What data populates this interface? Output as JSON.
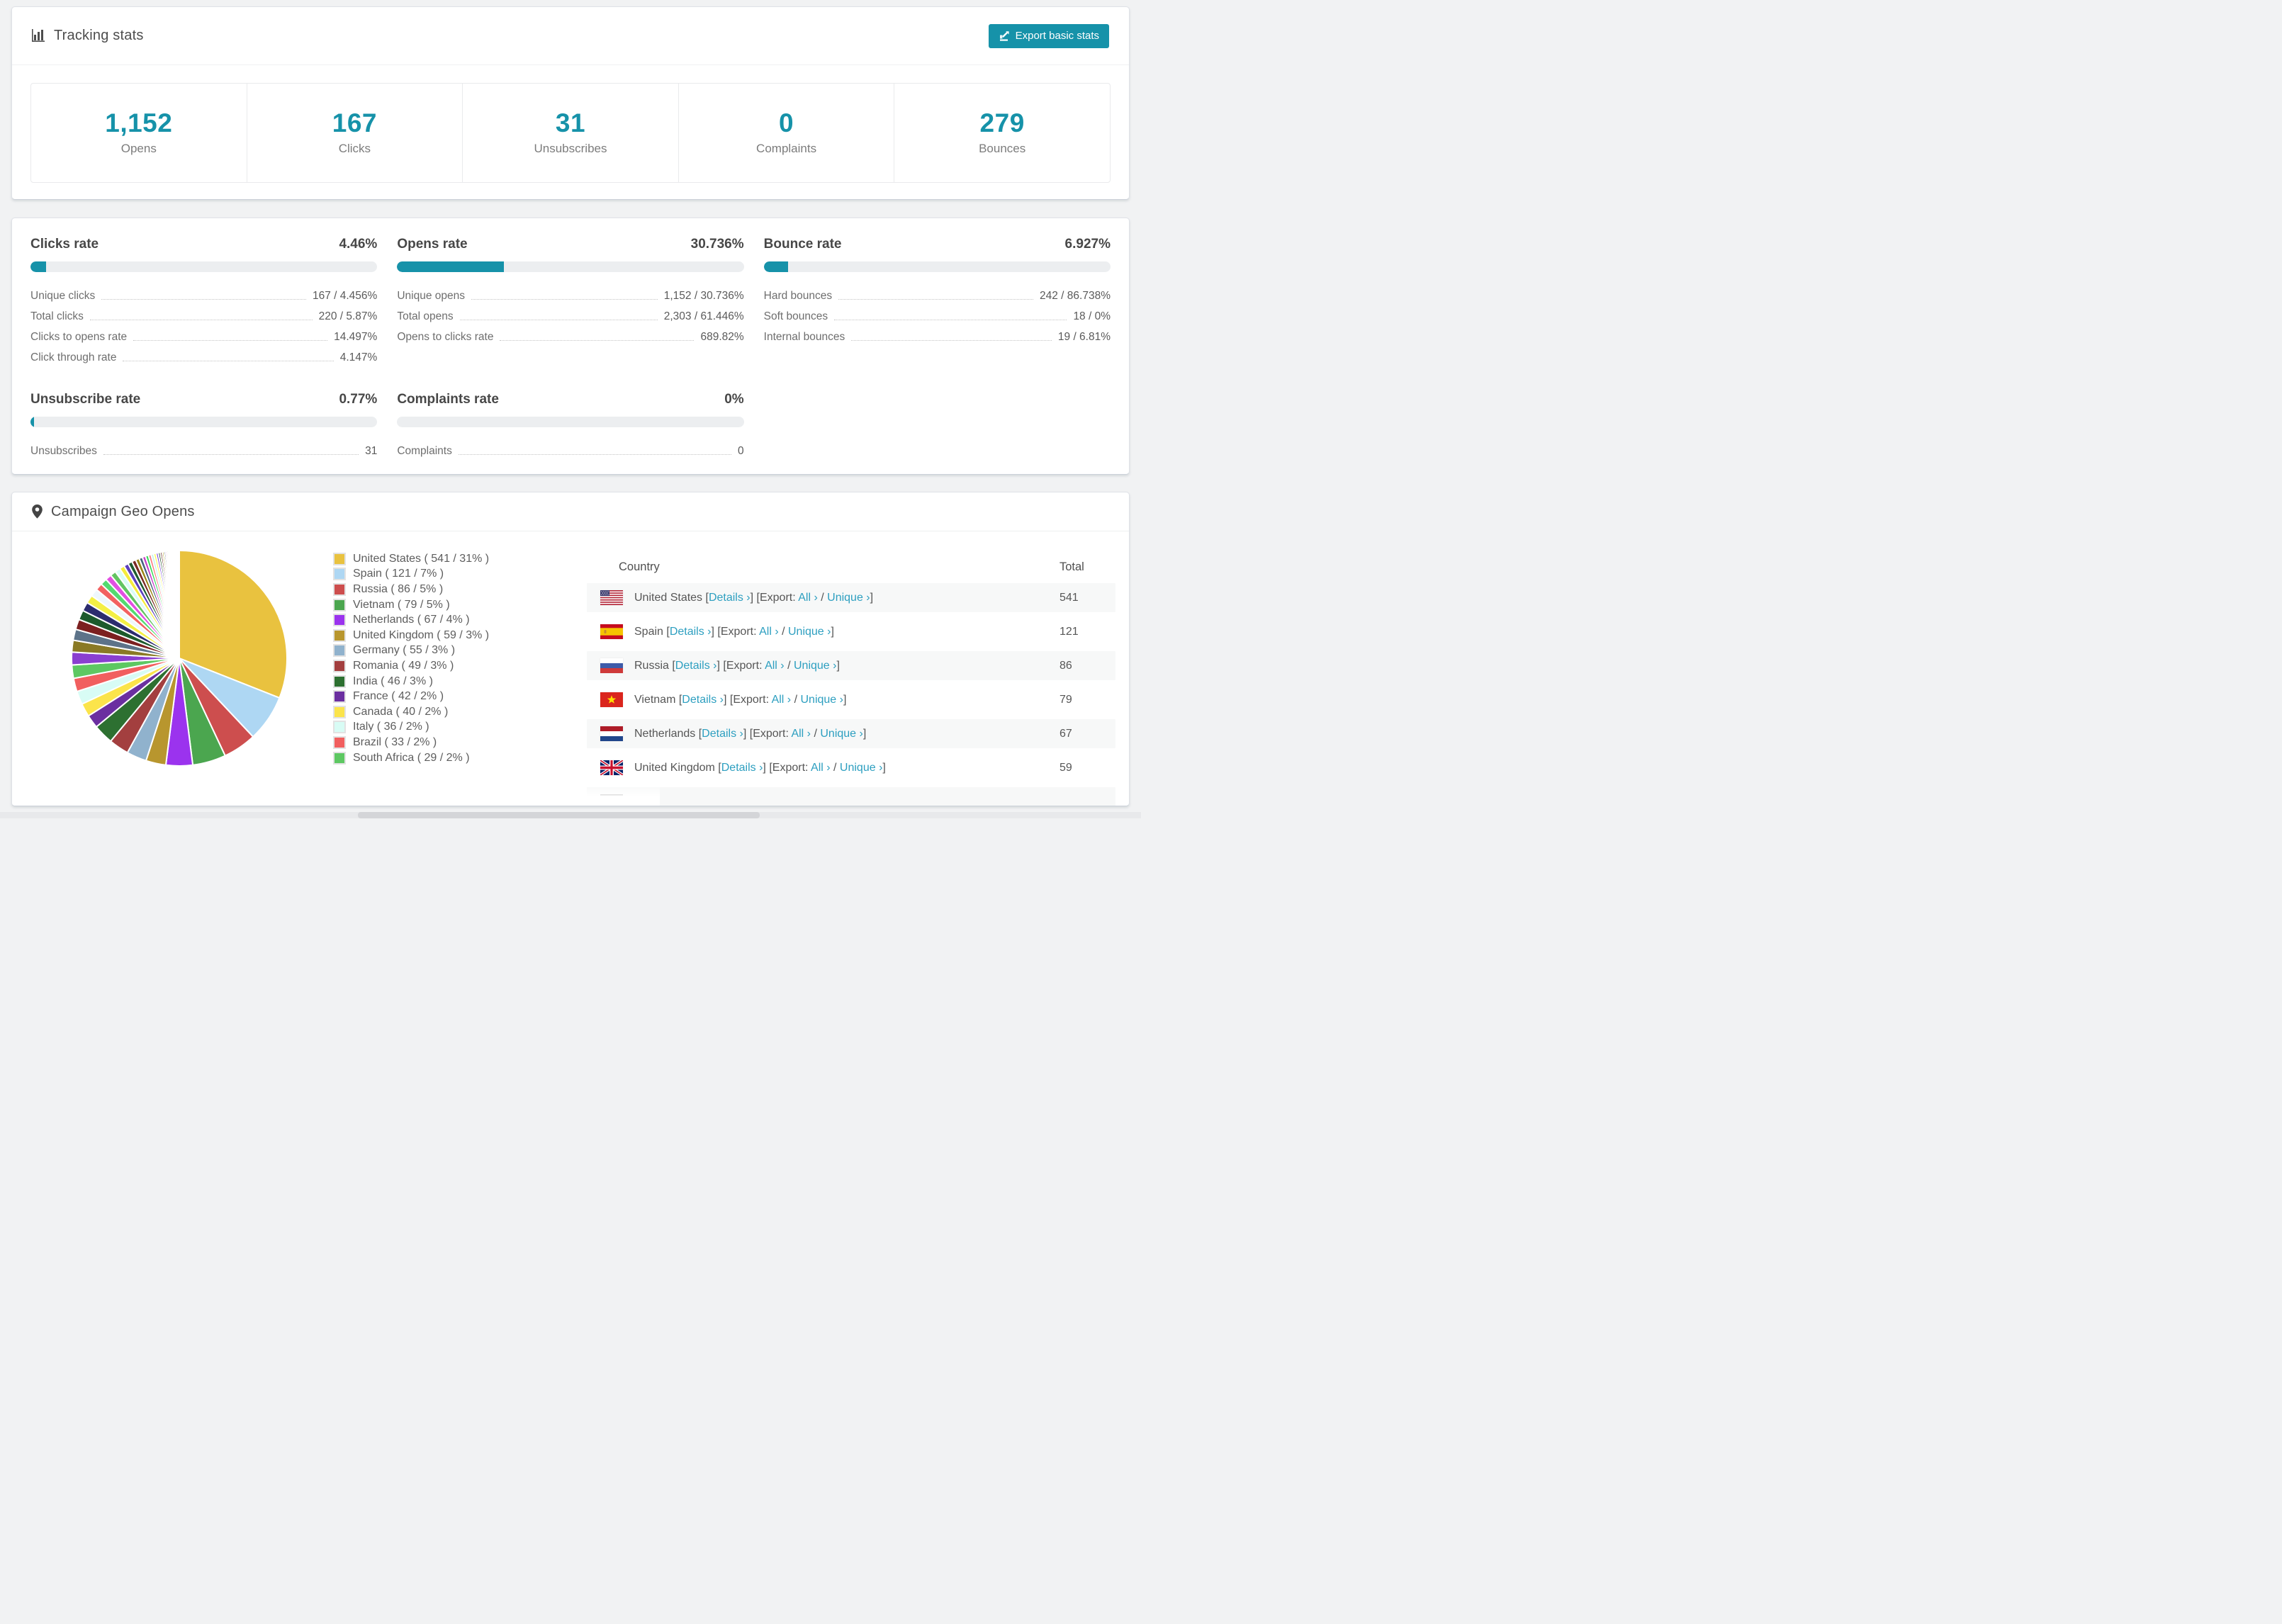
{
  "accent_color": "#1692a9",
  "link_color": "#2d9fc0",
  "header": {
    "title": "Tracking stats",
    "export_button": "Export basic stats",
    "icons": {
      "title": "bar-chart-icon",
      "export": "export-icon"
    }
  },
  "summary": [
    {
      "value": "1,152",
      "label": "Opens"
    },
    {
      "value": "167",
      "label": "Clicks"
    },
    {
      "value": "31",
      "label": "Unsubscribes"
    },
    {
      "value": "0",
      "label": "Complaints"
    },
    {
      "value": "279",
      "label": "Bounces"
    }
  ],
  "rates_order": [
    "clicks",
    "opens",
    "bounce",
    "unsubscribe",
    "complaints"
  ],
  "rates": {
    "clicks": {
      "title": "Clicks rate",
      "percent_label": "4.46%",
      "bar_percent": 4.46,
      "rows": [
        {
          "label": "Unique clicks",
          "value": "167 / 4.456%"
        },
        {
          "label": "Total clicks",
          "value": "220 / 5.87%"
        },
        {
          "label": "Clicks to opens rate",
          "value": "14.497%"
        },
        {
          "label": "Click through rate",
          "value": "4.147%"
        }
      ]
    },
    "opens": {
      "title": "Opens rate",
      "percent_label": "30.736%",
      "bar_percent": 30.736,
      "rows": [
        {
          "label": "Unique opens",
          "value": "1,152 / 30.736%"
        },
        {
          "label": "Total opens",
          "value": "2,303 / 61.446%"
        },
        {
          "label": "Opens to clicks rate",
          "value": "689.82%"
        }
      ]
    },
    "bounce": {
      "title": "Bounce rate",
      "percent_label": "6.927%",
      "bar_percent": 6.927,
      "rows": [
        {
          "label": "Hard bounces",
          "value": "242 / 86.738%"
        },
        {
          "label": "Soft bounces",
          "value": "18 / 0%"
        },
        {
          "label": "Internal bounces",
          "value": "19 / 6.81%"
        }
      ]
    },
    "unsubscribe": {
      "title": "Unsubscribe rate",
      "percent_label": "0.77%",
      "bar_percent": 0.77,
      "rows": [
        {
          "label": "Unsubscribes",
          "value": "31"
        }
      ]
    },
    "complaints": {
      "title": "Complaints rate",
      "percent_label": "0%",
      "bar_percent": 0,
      "rows": [
        {
          "label": "Complaints",
          "value": "0"
        }
      ]
    }
  },
  "geo": {
    "title": "Campaign Geo Opens",
    "icon": "map-pin-icon",
    "table": {
      "columns": [
        "Country",
        "Total"
      ],
      "link_labels": {
        "details": "Details",
        "export": "Export:",
        "all": "All",
        "unique": "Unique",
        "chevron": "›"
      },
      "rows": [
        {
          "country": "United States",
          "flag": "us",
          "total": "541"
        },
        {
          "country": "Spain",
          "flag": "es",
          "total": "121"
        },
        {
          "country": "Russia",
          "flag": "ru",
          "total": "86"
        },
        {
          "country": "Vietnam",
          "flag": "vn",
          "total": "79"
        },
        {
          "country": "Netherlands",
          "flag": "nl",
          "total": "67"
        },
        {
          "country": "United Kingdom",
          "flag": "gb",
          "total": "59"
        }
      ],
      "partial_row_flag": "de"
    },
    "chart_data": {
      "type": "pie",
      "title": "Campaign Geo Opens",
      "legend_position": "right-of-pie",
      "start_angle_deg": 0,
      "direction": "clockwise",
      "labels": [
        "United States",
        "Spain",
        "Russia",
        "Vietnam",
        "Netherlands",
        "United Kingdom",
        "Germany",
        "Romania",
        "India",
        "France",
        "Canada",
        "Italy",
        "Brazil",
        "South Africa"
      ],
      "counts": [
        541,
        121,
        86,
        79,
        67,
        59,
        55,
        49,
        46,
        42,
        40,
        36,
        33,
        29
      ],
      "percents": [
        31,
        7,
        5,
        5,
        4,
        3,
        3,
        3,
        3,
        2,
        2,
        2,
        2,
        2
      ],
      "colors": [
        "#e9c23f",
        "#aed7f3",
        "#cd4e4e",
        "#4ba64f",
        "#9b33ee",
        "#b8962e",
        "#90b2cd",
        "#a33f3f",
        "#2d7031",
        "#6b2fa0",
        "#fbe44b",
        "#d8fcf5",
        "#f15f5f",
        "#5dc862"
      ],
      "others_total_percent": 26,
      "others_colors": [
        "#8a3fd0",
        "#8a7a25",
        "#5d7389",
        "#7c2020",
        "#1d5a2c",
        "#2c2c6e",
        "#f4ef45",
        "#eef7fd",
        "#f26161",
        "#53da70",
        "#e24fe2",
        "#62c462",
        "#d9fdf6",
        "#f5ec3d",
        "#5b3fbc",
        "#1e5c2f",
        "#7a2a23",
        "#998515",
        "#47617f",
        "#c93ec9",
        "#35d957",
        "#ff7b7b",
        "#c0f4ec",
        "#fdfd4e",
        "#7744dd",
        "#174d20",
        "#54120d",
        "#b09a10",
        "#33475e",
        "#e066e0",
        "#27c947",
        "#ff8f8f",
        "#a8ece2",
        "#ffff66",
        "#8855ee",
        "#0f3d18",
        "#400d09",
        "#c8ae0c",
        "#24364a",
        "#f080f0",
        "#1cbd3a",
        "#ffa3a3"
      ]
    }
  }
}
